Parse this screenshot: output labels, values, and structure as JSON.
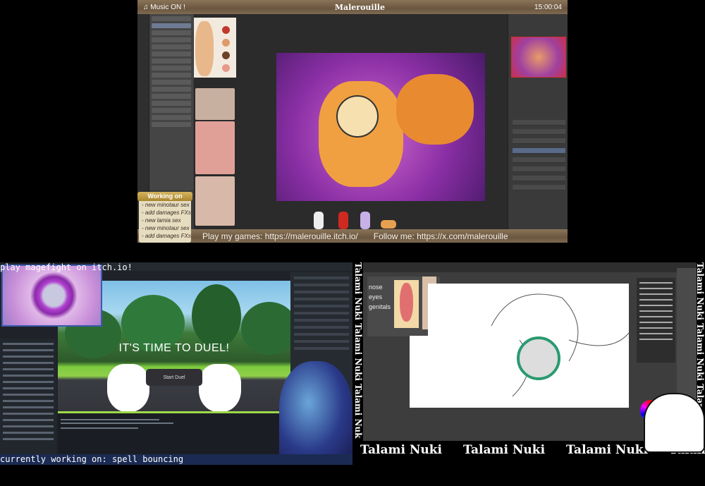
{
  "top_stream": {
    "music_status": "Music ON !",
    "title_logo": "Malerouille",
    "clock": "15:00:04",
    "working_on": {
      "header": "Working on",
      "items": [
        "- new minotaur sex",
        "- add damages FXs",
        "- new lamia sex",
        "- new minotaur sex",
        "- add damages FXs"
      ]
    },
    "footer_links": {
      "games": "Play my games: https://malerouille.itch.io/",
      "follow": "Follow me: https://x.com/malerouille"
    },
    "palette_colors": [
      "#c0392b",
      "#e09a6a",
      "#6b4226",
      "#e89a8a"
    ]
  },
  "bottom_left_stream": {
    "banner": "play magefight on itch.io!",
    "game_title": "IT'S TIME TO DUEL!",
    "start_button": "Start Duel",
    "status": "currently working on: spell bouncing"
  },
  "bottom_right_stream": {
    "reference_notes": [
      "nose",
      "eyes",
      "genitals"
    ],
    "streamer_name": "Talami Nuki",
    "side_name": "Talami Nuki Talami Nuki Talami Nuki"
  }
}
